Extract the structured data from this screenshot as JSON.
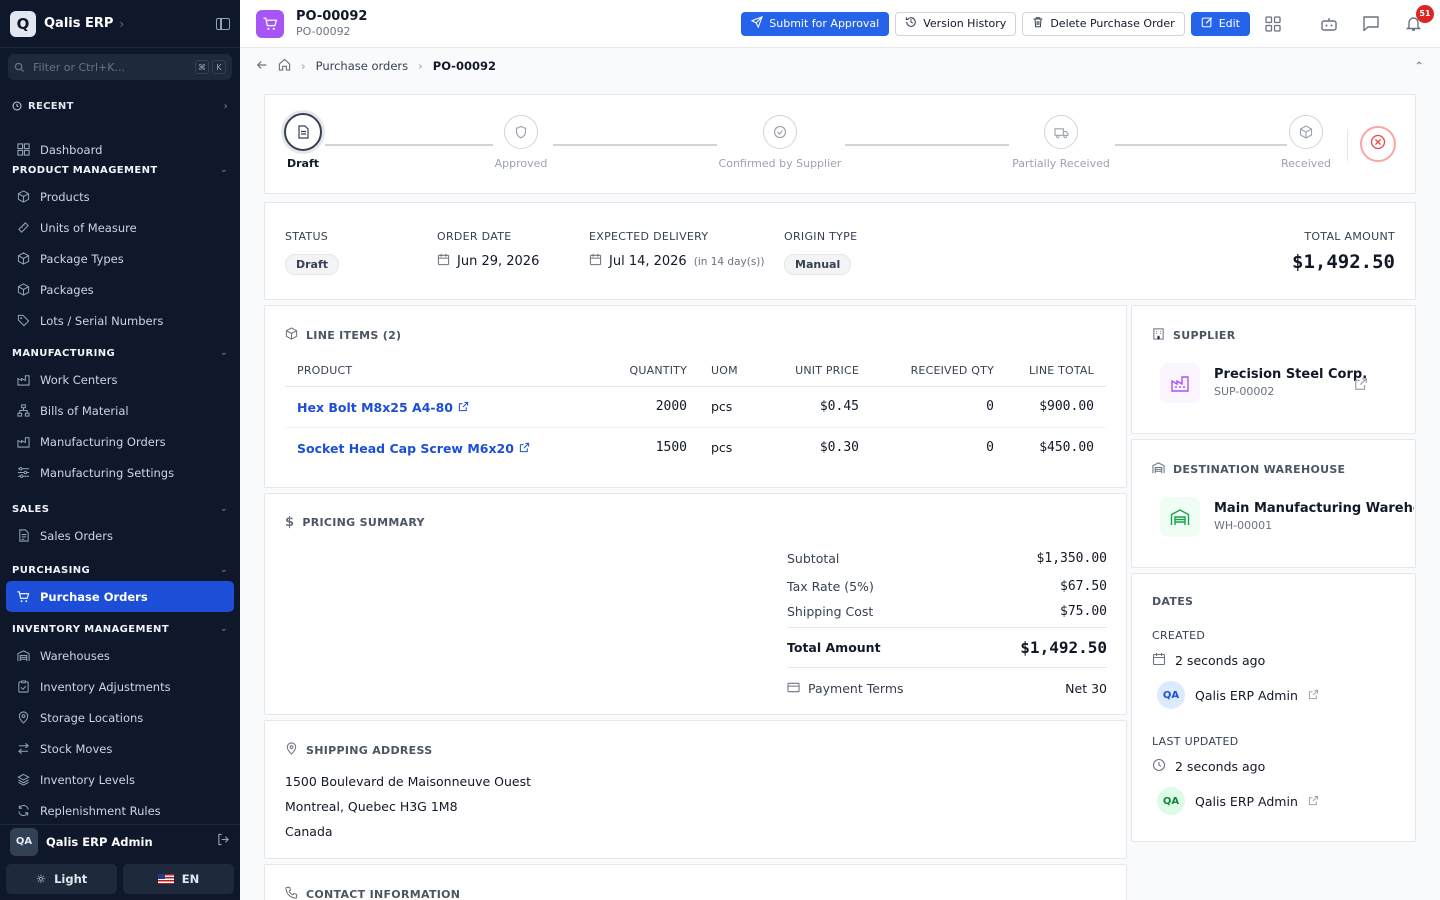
{
  "app": {
    "logo": "Q",
    "name": "Qalis ERP"
  },
  "sidebar": {
    "filter_placeholder": "Filter or Ctrl+K...",
    "kbd1": "⌘",
    "kbd2": "K",
    "recent": "RECENT",
    "dashboard": "Dashboard",
    "sections": [
      {
        "title": "PRODUCT MANAGEMENT",
        "items": [
          "Products",
          "Units of Measure",
          "Package Types",
          "Packages",
          "Lots / Serial Numbers"
        ]
      },
      {
        "title": "MANUFACTURING",
        "items": [
          "Work Centers",
          "Bills of Material",
          "Manufacturing Orders",
          "Manufacturing Settings"
        ]
      },
      {
        "title": "SALES",
        "items": [
          "Sales Orders"
        ]
      },
      {
        "title": "PURCHASING",
        "items": [
          "Purchase Orders"
        ]
      },
      {
        "title": "INVENTORY MANAGEMENT",
        "items": [
          "Warehouses",
          "Inventory Adjustments",
          "Storage Locations",
          "Stock Moves",
          "Inventory Levels",
          "Replenishment Rules"
        ]
      }
    ],
    "user_initials": "QA",
    "user_name": "Qalis ERP Admin",
    "theme_label": "Light",
    "lang_label": "EN"
  },
  "header": {
    "title": "PO-00092",
    "subtitle": "PO-00092",
    "submit": "Submit for Approval",
    "history": "Version History",
    "delete": "Delete Purchase Order",
    "edit": "Edit",
    "notif_count": "51"
  },
  "breadcrumb": {
    "parent": "Purchase orders",
    "current": "PO-00092"
  },
  "steps": [
    "Draft",
    "Approved",
    "Confirmed by Supplier",
    "Partially Received",
    "Received"
  ],
  "summary": {
    "status_label": "STATUS",
    "status": "Draft",
    "order_date_label": "ORDER DATE",
    "order_date": "Jun 29, 2026",
    "expected_label": "EXPECTED DELIVERY",
    "expected": "Jul 14, 2026",
    "expected_note": "(in 14 day(s))",
    "origin_label": "ORIGIN TYPE",
    "origin": "Manual",
    "total_label": "TOTAL AMOUNT",
    "total": "$1,492.50"
  },
  "line_items": {
    "title": "LINE ITEMS (2)",
    "columns": [
      "PRODUCT",
      "QUANTITY",
      "UOM",
      "UNIT PRICE",
      "RECEIVED QTY",
      "LINE TOTAL"
    ],
    "rows": [
      {
        "product": "Hex Bolt M8x25 A4-80",
        "qty": "2000",
        "uom": "pcs",
        "price": "$0.45",
        "received": "0",
        "total": "$900.00"
      },
      {
        "product": "Socket Head Cap Screw M6x20",
        "qty": "1500",
        "uom": "pcs",
        "price": "$0.30",
        "received": "0",
        "total": "$450.00"
      }
    ]
  },
  "pricing": {
    "title": "PRICING SUMMARY",
    "subtotal_label": "Subtotal",
    "subtotal": "$1,350.00",
    "tax_label": "Tax Rate (5%)",
    "tax": "$67.50",
    "shipping_label": "Shipping Cost",
    "shipping": "$75.00",
    "total_label": "Total Amount",
    "total": "$1,492.50",
    "terms_label": "Payment Terms",
    "terms": "Net 30"
  },
  "shipping": {
    "title": "SHIPPING ADDRESS",
    "line1": "1500 Boulevard de Maisonneuve Ouest",
    "line2": "Montreal, Quebec H3G 1M8",
    "line3": "Canada"
  },
  "contact": {
    "title": "CONTACT INFORMATION"
  },
  "supplier": {
    "title": "SUPPLIER",
    "name": "Precision Steel Corp.",
    "code": "SUP-00002"
  },
  "warehouse": {
    "title": "DESTINATION WAREHOUSE",
    "name": "Main Manufacturing Warehouse",
    "code": "WH-00001"
  },
  "dates": {
    "title": "DATES",
    "created_label": "CREATED",
    "created": "2 seconds ago",
    "created_by_initials": "QA",
    "created_by": "Qalis ERP Admin",
    "updated_label": "LAST UPDATED",
    "updated": "2 seconds ago",
    "updated_by_initials": "QA",
    "updated_by": "Qalis ERP Admin"
  },
  "colors": {
    "primary": "#2563eb",
    "sidebar": "#0f172a",
    "po_icon": "#a855f7",
    "cancel": "#ef4444"
  }
}
